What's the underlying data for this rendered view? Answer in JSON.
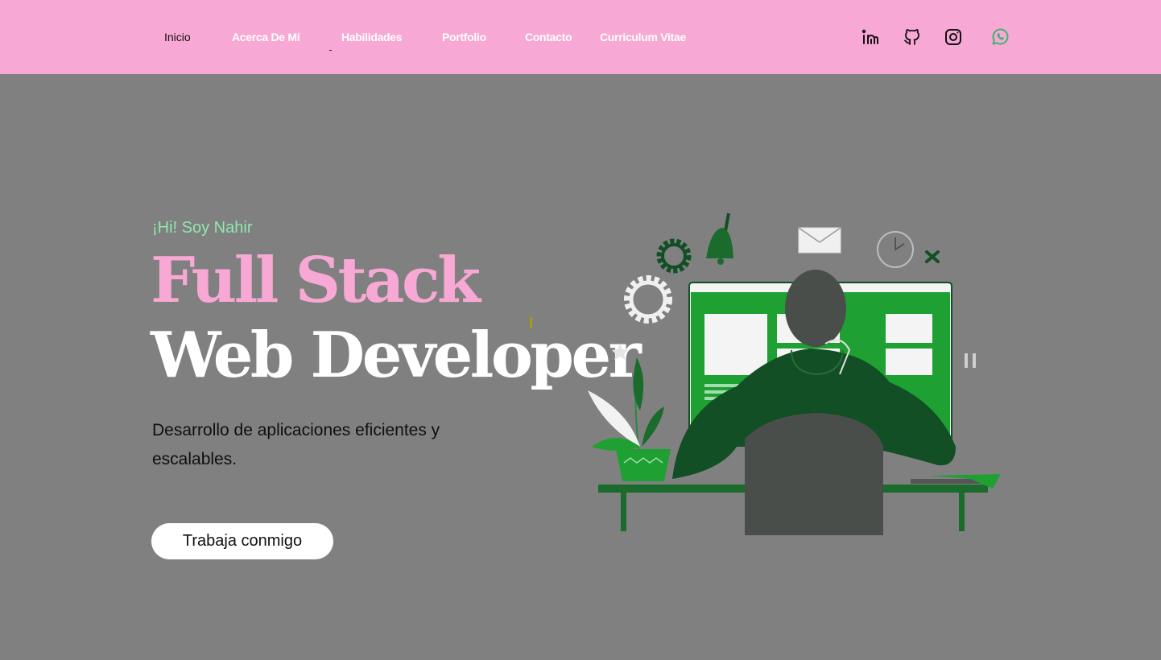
{
  "nav": {
    "links": [
      "Inicio",
      "Acerca De Mí",
      "Habilidades",
      "Portfolio",
      "Contacto",
      "Curriculum Vitae"
    ],
    "active_index": 0
  },
  "social": [
    {
      "name": "linkedin",
      "icon": "linkedin-icon",
      "color": "#111111"
    },
    {
      "name": "github",
      "icon": "github-icon",
      "color": "#111111"
    },
    {
      "name": "instagram",
      "icon": "instagram-icon",
      "color": "#111111"
    },
    {
      "name": "whatsapp",
      "icon": "whatsapp-icon",
      "color": "#3cb371"
    }
  ],
  "hero": {
    "greeting": "¡Hi! Soy Nahir",
    "title_line1": "Full Stack",
    "title_line2": "Web Developer",
    "description": "Desarrollo de aplicaciones eficientes y escalables.",
    "cta_label": "Trabaja conmigo"
  },
  "illustration": {
    "icon": "developer-at-desk-illustration"
  },
  "colors": {
    "navbar_bg": "#f8a8d4",
    "page_bg": "#808080",
    "accent_pink": "#f8a8d4",
    "accent_green": "#8fe7b0",
    "illustration_green": "#1fa032",
    "illustration_dark_green": "#124f24"
  }
}
